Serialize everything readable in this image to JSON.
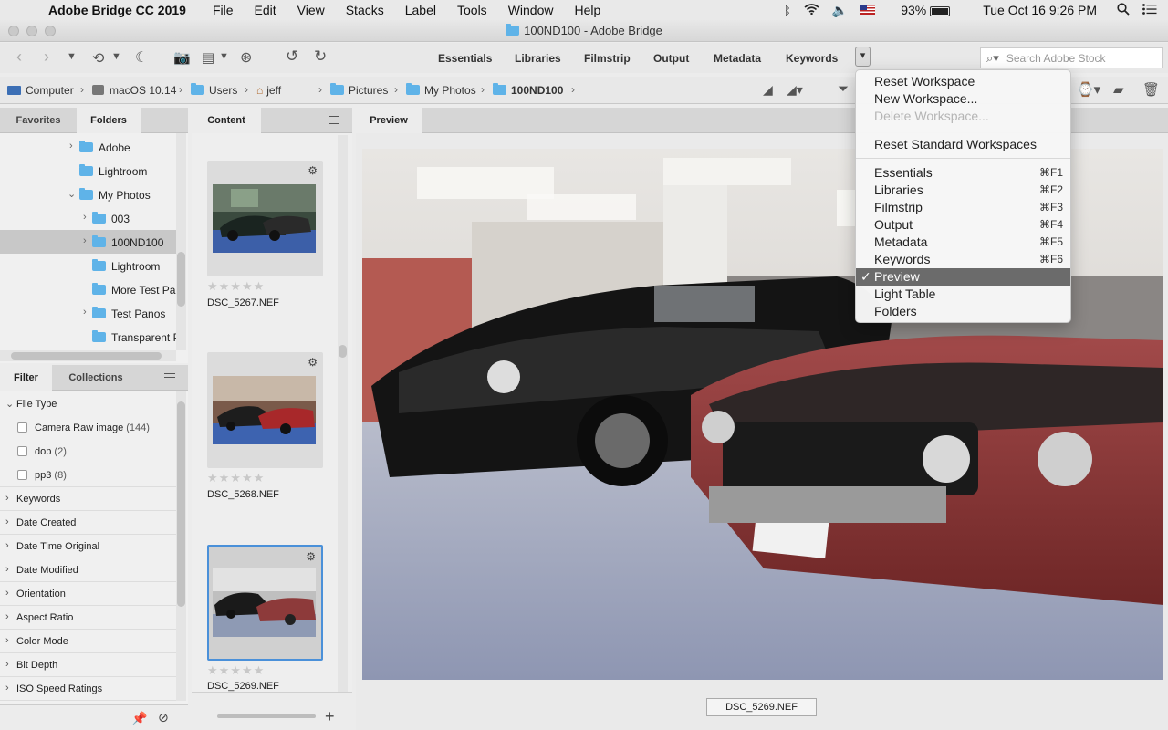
{
  "menubar": {
    "app_name": "Adobe Bridge CC 2019",
    "menus": [
      "File",
      "Edit",
      "View",
      "Stacks",
      "Label",
      "Tools",
      "Window",
      "Help"
    ],
    "battery": "93%",
    "clock": "Tue Oct 16  9:26 PM"
  },
  "window": {
    "title": "100ND100 - Adobe Bridge"
  },
  "toolbar": {
    "workspaces": [
      "Essentials",
      "Libraries",
      "Filmstrip",
      "Output",
      "Metadata",
      "Keywords"
    ],
    "search_placeholder": "Search Adobe Stock"
  },
  "pathbar": {
    "crumbs": [
      "Computer",
      "macOS 10.14",
      "Users",
      "jeff",
      "Pictures",
      "My Photos",
      "100ND100"
    ]
  },
  "left_top": {
    "tabs": [
      "Favorites",
      "Folders"
    ],
    "folders": [
      {
        "label": "Adobe",
        "expandable": true
      },
      {
        "label": "Lightroom",
        "expandable": false
      },
      {
        "label": "My Photos",
        "expandable": true,
        "expanded": true
      },
      {
        "label": "003",
        "expandable": true
      },
      {
        "label": "100ND100",
        "expandable": true,
        "selected": true
      },
      {
        "label": "Lightroom",
        "expandable": false
      },
      {
        "label": "More Test Par",
        "expandable": false
      },
      {
        "label": "Test Panos",
        "expandable": true
      },
      {
        "label": "Transparent P",
        "expandable": false
      }
    ]
  },
  "left_bottom": {
    "tabs": [
      "Filter",
      "Collections"
    ],
    "file_type_header": "File Type",
    "file_types": [
      {
        "label": "Camera Raw image",
        "count": "(144)"
      },
      {
        "label": "dop",
        "count": "(2)"
      },
      {
        "label": "pp3",
        "count": "(8)"
      }
    ],
    "categories": [
      "Keywords",
      "Date Created",
      "Date Time Original",
      "Date Modified",
      "Orientation",
      "Aspect Ratio",
      "Color Mode",
      "Bit Depth",
      "ISO Speed Ratings"
    ]
  },
  "content": {
    "tab": "Content",
    "items": [
      {
        "filename": "DSC_5267.NEF",
        "stars": "★★★★★"
      },
      {
        "filename": "DSC_5268.NEF",
        "stars": "★★★★★"
      },
      {
        "filename": "DSC_5269.NEF",
        "stars": "★★★★★"
      }
    ]
  },
  "preview": {
    "tab": "Preview",
    "caption": "DSC_5269.NEF"
  },
  "workspace_menu": {
    "items": [
      {
        "label": "Reset Workspace",
        "shortcut": ""
      },
      {
        "label": "New Workspace...",
        "shortcut": ""
      },
      {
        "label": "Delete Workspace...",
        "shortcut": "",
        "disabled": true
      },
      {
        "label": "Reset Standard Workspaces",
        "shortcut": ""
      },
      {
        "label": "Essentials",
        "shortcut": "⌘F1"
      },
      {
        "label": "Libraries",
        "shortcut": "⌘F2"
      },
      {
        "label": "Filmstrip",
        "shortcut": "⌘F3"
      },
      {
        "label": "Output",
        "shortcut": "⌘F4"
      },
      {
        "label": "Metadata",
        "shortcut": "⌘F5"
      },
      {
        "label": "Keywords",
        "shortcut": "⌘F6"
      },
      {
        "label": "Preview",
        "shortcut": "",
        "checked": true
      },
      {
        "label": "Light Table",
        "shortcut": ""
      },
      {
        "label": "Folders",
        "shortcut": ""
      }
    ],
    "checkmark": "✓"
  },
  "colors": {
    "accent": "#4a90d9",
    "folder": "#5fb3e8",
    "menu_highlight": "#6b6b6b"
  }
}
